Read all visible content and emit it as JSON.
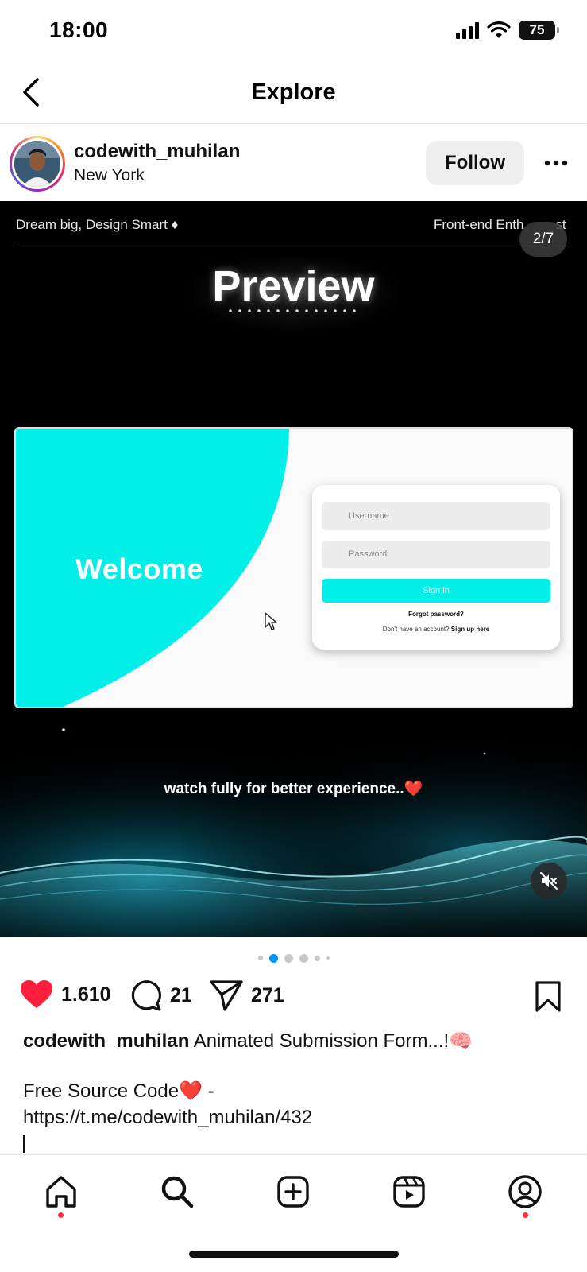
{
  "status_bar": {
    "time": "18:00",
    "battery": "75"
  },
  "header": {
    "title": "Explore"
  },
  "post": {
    "username": "codewith_muhilan",
    "location": "New York",
    "follow_label": "Follow"
  },
  "media": {
    "top_left_text": "Dream big, Design Smart ♦",
    "top_right_text": "Front-end Enth",
    "top_right_text_tail": "st",
    "slide_counter": "2/7",
    "preview_title": "Preview",
    "mockup": {
      "welcome": "Welcome",
      "username_placeholder": "Username",
      "password_placeholder": "Password",
      "signin_label": "Sign in",
      "forgot": "Forgot password?",
      "signup_prefix": "Don't have an account?",
      "signup_link": "Sign up here"
    },
    "watch_text": "watch fully for better experience..",
    "watch_emoji": "❤️"
  },
  "carousel": {
    "dot_count": 6,
    "active_index": 1
  },
  "actions": {
    "likes": "1.610",
    "comments": "21",
    "shares": "271"
  },
  "caption": {
    "username": "codewith_muhilan",
    "text": "Animated Submission Form...!🧠",
    "line2": "Free Source Code❤️ -",
    "line3": "https://t.me/codewith_muhilan/432"
  },
  "colors": {
    "accent_cyan": "#00f0e8",
    "like_red": "#ff1f3d",
    "active_dot": "#0095f6",
    "notification_dot": "#ff3040"
  },
  "tabbar": {
    "items": [
      "home-icon",
      "search-icon",
      "create-icon",
      "reels-icon",
      "profile-icon"
    ]
  }
}
